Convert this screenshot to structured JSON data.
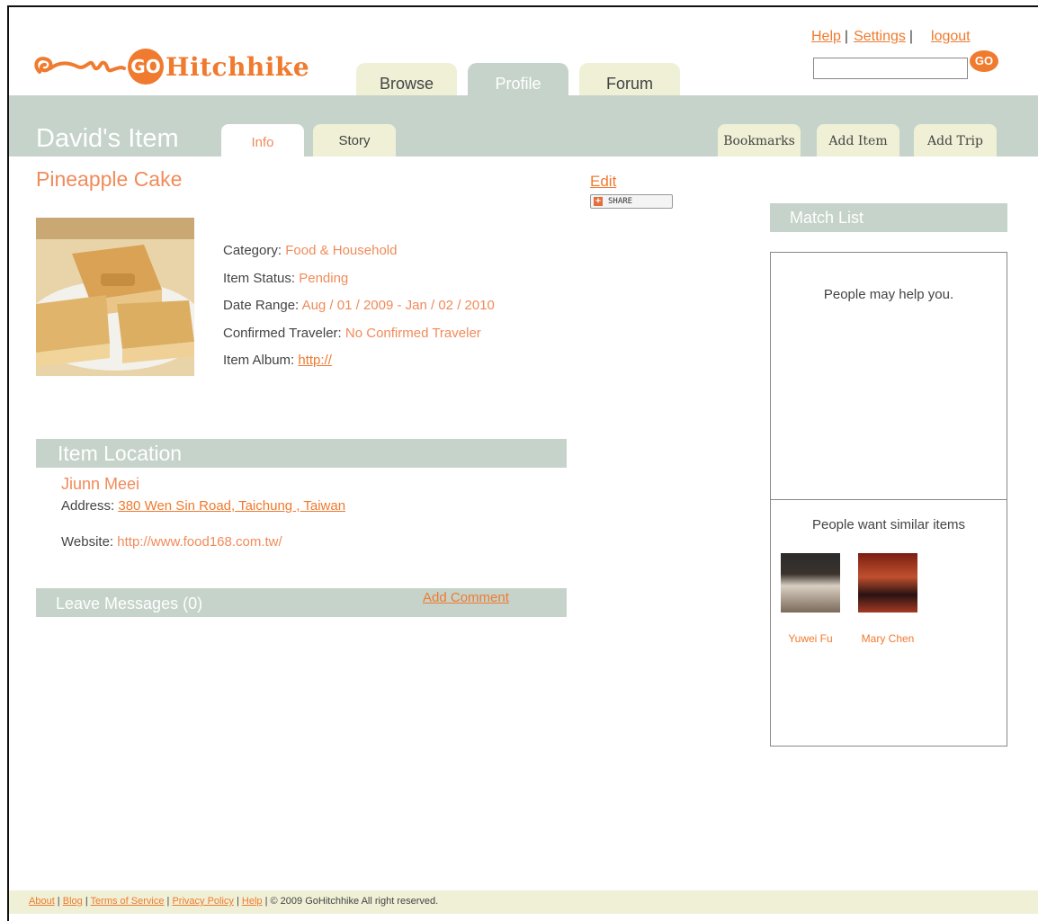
{
  "brand": {
    "logo_go": "GO",
    "logo_text": "Hitchhike"
  },
  "top_tabs": [
    {
      "label": "Browse"
    },
    {
      "label": "Profile"
    },
    {
      "label": "Forum"
    }
  ],
  "top_links": {
    "help": "Help",
    "settings": "Settings",
    "logout": "logout",
    "sep": "|"
  },
  "search": {
    "value": "",
    "go_label": "GO"
  },
  "header": {
    "title": "David's Item"
  },
  "sub_tabs": {
    "info": "Info",
    "story": "Story",
    "bookmarks": "Bookmarks",
    "add_item": "Add Item",
    "add_trip": "Add Trip"
  },
  "item": {
    "title": "Pineapple Cake",
    "edit_label": "Edit",
    "share_label": "SHARE",
    "details": [
      {
        "label": "Category:",
        "value": "Food & Household"
      },
      {
        "label": "Item Status:",
        "value": "Pending"
      },
      {
        "label": "Date Range:",
        "value": "Aug / 01 / 2009 - Jan / 02 / 2010"
      },
      {
        "label": "Confirmed Traveler:",
        "value": "No Confirmed Traveler"
      },
      {
        "label": "Item Album:",
        "value": "http://"
      }
    ]
  },
  "location": {
    "section_title": "Item Location",
    "name": "Jiunn Meei",
    "address_label": "Address:",
    "address": "380 Wen Sin Road, Taichung , Taiwan",
    "website_label": "Website:",
    "website": "http://www.food168.com.tw/"
  },
  "messages": {
    "section_title": "Leave Messages (0)",
    "add_comment": "Add Comment"
  },
  "match_list": {
    "title": "Match List",
    "help_text": "People may help you.",
    "similar_text": "People want similar items",
    "people": [
      {
        "name": "Yuwei Fu"
      },
      {
        "name": "Mary Chen"
      }
    ]
  },
  "footer": {
    "about": "About",
    "blog": "Blog",
    "terms": "Terms of Service",
    "privacy": "Privacy Policy",
    "help": "Help",
    "copyright": "© 2009 GoHitchhike All right reserved."
  },
  "colors": {
    "accent": "#f07a2e",
    "band": "#c6d3ca",
    "tab_light": "#eff0d6",
    "text_orange": "#f08b5a"
  }
}
